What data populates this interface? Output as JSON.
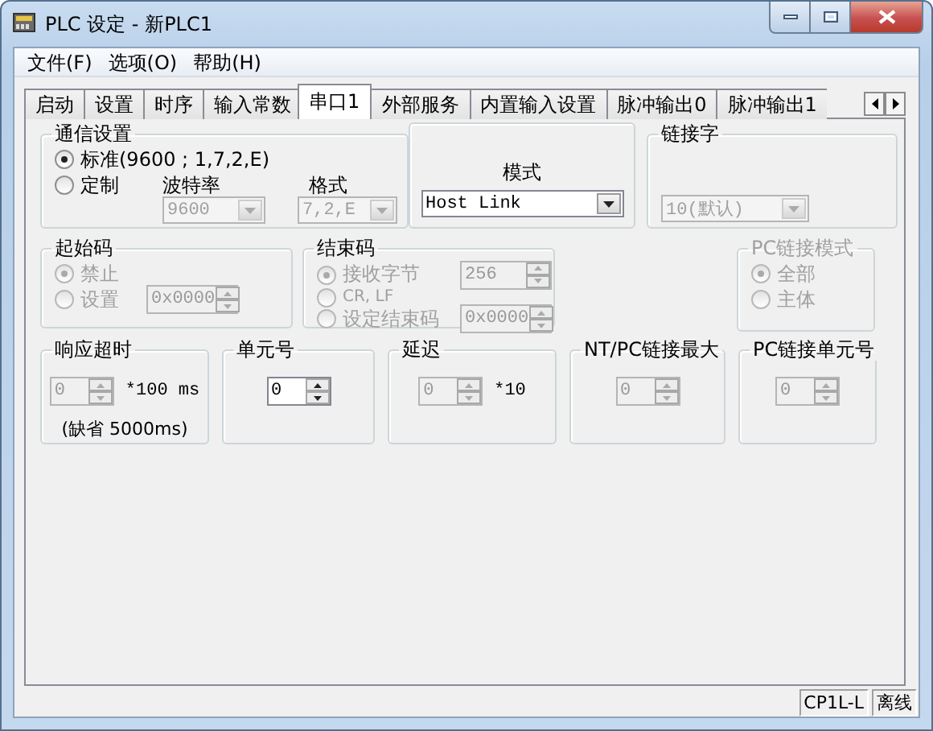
{
  "window": {
    "title": "PLC 设定 - 新PLC1"
  },
  "menu": [
    "文件(F)",
    "选项(O)",
    "帮助(H)"
  ],
  "tabs": [
    {
      "label": "启动",
      "selected": false
    },
    {
      "label": "设置",
      "selected": false
    },
    {
      "label": "时序",
      "selected": false
    },
    {
      "label": "输入常数",
      "selected": false
    },
    {
      "label": "串口1",
      "selected": true
    },
    {
      "label": "外部服务",
      "selected": false
    },
    {
      "label": "内置输入设置",
      "selected": false
    },
    {
      "label": "脉冲输出0",
      "selected": false
    },
    {
      "label": "脉冲输出1",
      "selected": false
    }
  ],
  "comm_settings": {
    "title": "通信设置",
    "options": [
      {
        "label": "标准(9600 ; 1,7,2,E)",
        "selected": true
      },
      {
        "label": "定制",
        "selected": false
      }
    ],
    "baud_rate": {
      "label": "波特率",
      "value": "9600",
      "disabled": true
    },
    "format": {
      "label": "格式",
      "value": "7,2,E",
      "disabled": true
    }
  },
  "mode": {
    "label": "模式",
    "value": "Host Link",
    "disabled": false
  },
  "link_word": {
    "title": "链接字",
    "value": "10(默认)",
    "disabled": true
  },
  "start_code": {
    "title": "起始码",
    "options_disabled": true,
    "options": [
      {
        "label": "禁止",
        "selected": true
      },
      {
        "label": "设置",
        "selected": false
      }
    ],
    "value": "0x0000"
  },
  "end_code": {
    "title": "结束码",
    "options_disabled": true,
    "options": [
      {
        "label": "接收字节",
        "selected": true
      },
      {
        "label": "CR, LF",
        "selected": false
      },
      {
        "label": "设定结束码",
        "selected": false
      }
    ],
    "received_bytes": "256",
    "code_value": "0x0000"
  },
  "pc_link_mode": {
    "title": "PC链接模式",
    "disabled": true,
    "options": [
      {
        "label": "全部",
        "selected": true
      },
      {
        "label": "主体",
        "selected": false
      }
    ]
  },
  "settings": [
    {
      "title": "响应超时",
      "value": "0",
      "disabled": true,
      "unit": "*100 ms",
      "note": "(缺省 5000ms)"
    },
    {
      "title": "单元号",
      "value": "0",
      "disabled": false
    },
    {
      "title": "延迟",
      "value": "0",
      "disabled": true,
      "unit": "*10"
    },
    {
      "title": "NT/PC链接最大",
      "value": "0",
      "disabled": true
    },
    {
      "title": "PC链接单元号",
      "value": "0",
      "disabled": true
    }
  ],
  "status_bar": [
    "CP1L-L",
    "离线"
  ]
}
